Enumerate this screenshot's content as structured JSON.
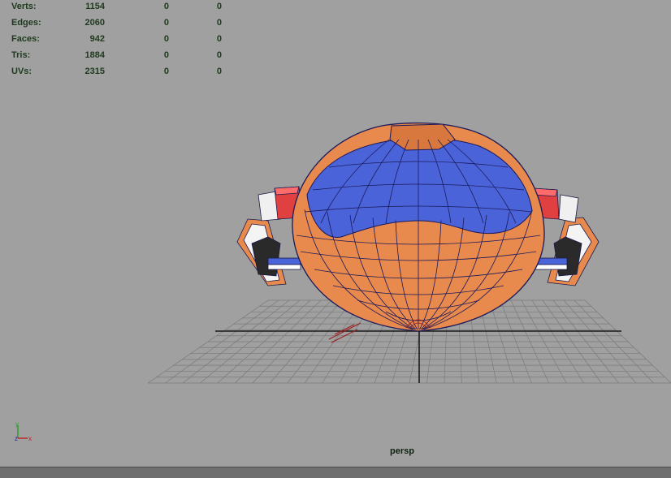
{
  "hud": {
    "rows": [
      {
        "label": "Verts:",
        "v1": "1154",
        "v2": "0",
        "v3": "0"
      },
      {
        "label": "Edges:",
        "v1": "2060",
        "v2": "0",
        "v3": "0"
      },
      {
        "label": "Faces:",
        "v1": "942",
        "v2": "0",
        "v3": "0"
      },
      {
        "label": "Tris:",
        "v1": "1884",
        "v2": "0",
        "v3": "0"
      },
      {
        "label": "UVs:",
        "v1": "2315",
        "v2": "0",
        "v3": "0"
      }
    ]
  },
  "viewport": {
    "camera": "persp",
    "background_color": "#a0a0a0",
    "model_colors": {
      "orange": "#e8894e",
      "blue": "#4a63d8",
      "red": "#e04040",
      "wire": "#20205a"
    }
  },
  "axis": {
    "y": "y",
    "x": "x",
    "z": "z"
  }
}
